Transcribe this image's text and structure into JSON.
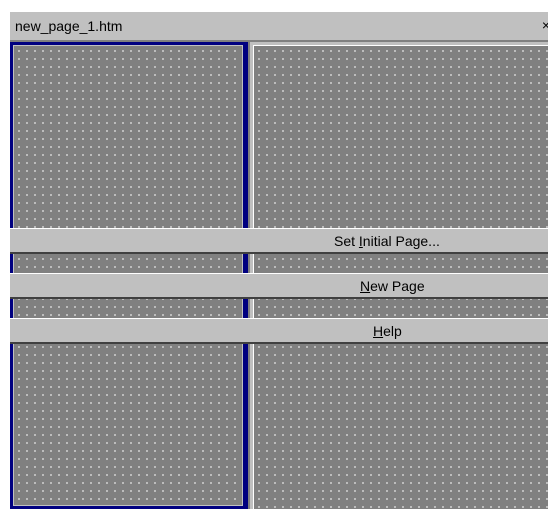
{
  "window": {
    "title": "new_page_1.htm",
    "close_glyph": "×"
  },
  "menu": {
    "set_initial_page": {
      "before": "Set ",
      "accel": "I",
      "after": "nitial Page..."
    },
    "new_page": {
      "before": "",
      "accel": "N",
      "after": "ew Page"
    },
    "help": {
      "before": "",
      "accel": "H",
      "after": "elp"
    }
  },
  "colors": {
    "frame_background": "#808080",
    "dots": "#dcdcdc",
    "selected_frame_border": "#000080",
    "chrome": "#c0c0c0"
  }
}
